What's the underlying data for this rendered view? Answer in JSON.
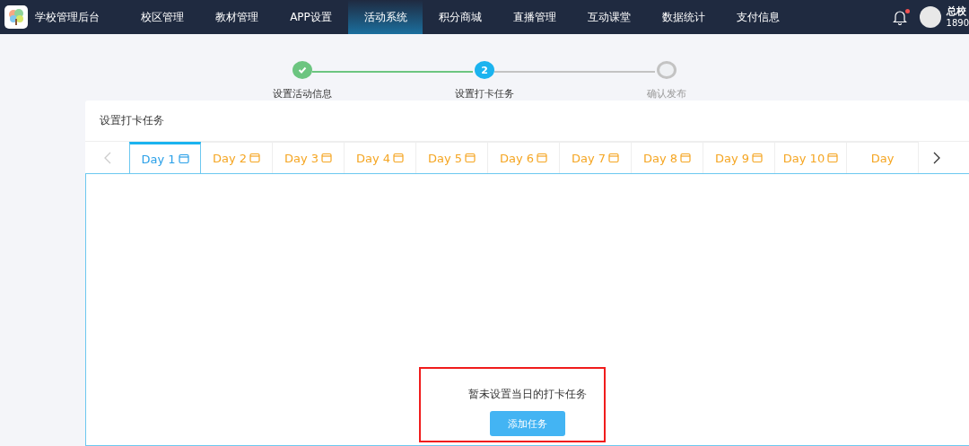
{
  "nav": {
    "brand": "学校管理后台",
    "items": [
      {
        "label": "校区管理",
        "selected": false
      },
      {
        "label": "教材管理",
        "selected": false
      },
      {
        "label": "APP设置",
        "selected": false
      },
      {
        "label": "活动系统",
        "selected": true
      },
      {
        "label": "积分商城",
        "selected": false
      },
      {
        "label": "直播管理",
        "selected": false
      },
      {
        "label": "互动课堂",
        "selected": false
      },
      {
        "label": "数据统计",
        "selected": false
      },
      {
        "label": "支付信息",
        "selected": false
      }
    ],
    "notification_dot": true,
    "user": {
      "name": "总校",
      "phone": "1890"
    }
  },
  "steps": [
    {
      "label": "设置活动信息",
      "kind": "done"
    },
    {
      "label": "设置打卡任务",
      "kind": "active",
      "number": "2"
    },
    {
      "label": "确认发布",
      "kind": "pending"
    }
  ],
  "card": {
    "title": "设置打卡任务",
    "day_tabs": [
      {
        "label": "Day 1",
        "selected": true
      },
      {
        "label": "Day 2",
        "selected": false
      },
      {
        "label": "Day 3",
        "selected": false
      },
      {
        "label": "Day 4",
        "selected": false
      },
      {
        "label": "Day 5",
        "selected": false
      },
      {
        "label": "Day 6",
        "selected": false
      },
      {
        "label": "Day 7",
        "selected": false
      },
      {
        "label": "Day 8",
        "selected": false
      },
      {
        "label": "Day 9",
        "selected": false
      },
      {
        "label": "Day 10",
        "selected": false
      },
      {
        "label": "Day",
        "selected": false
      }
    ],
    "empty_message": "暂未设置当日的打卡任务",
    "add_button": "添加任务"
  }
}
